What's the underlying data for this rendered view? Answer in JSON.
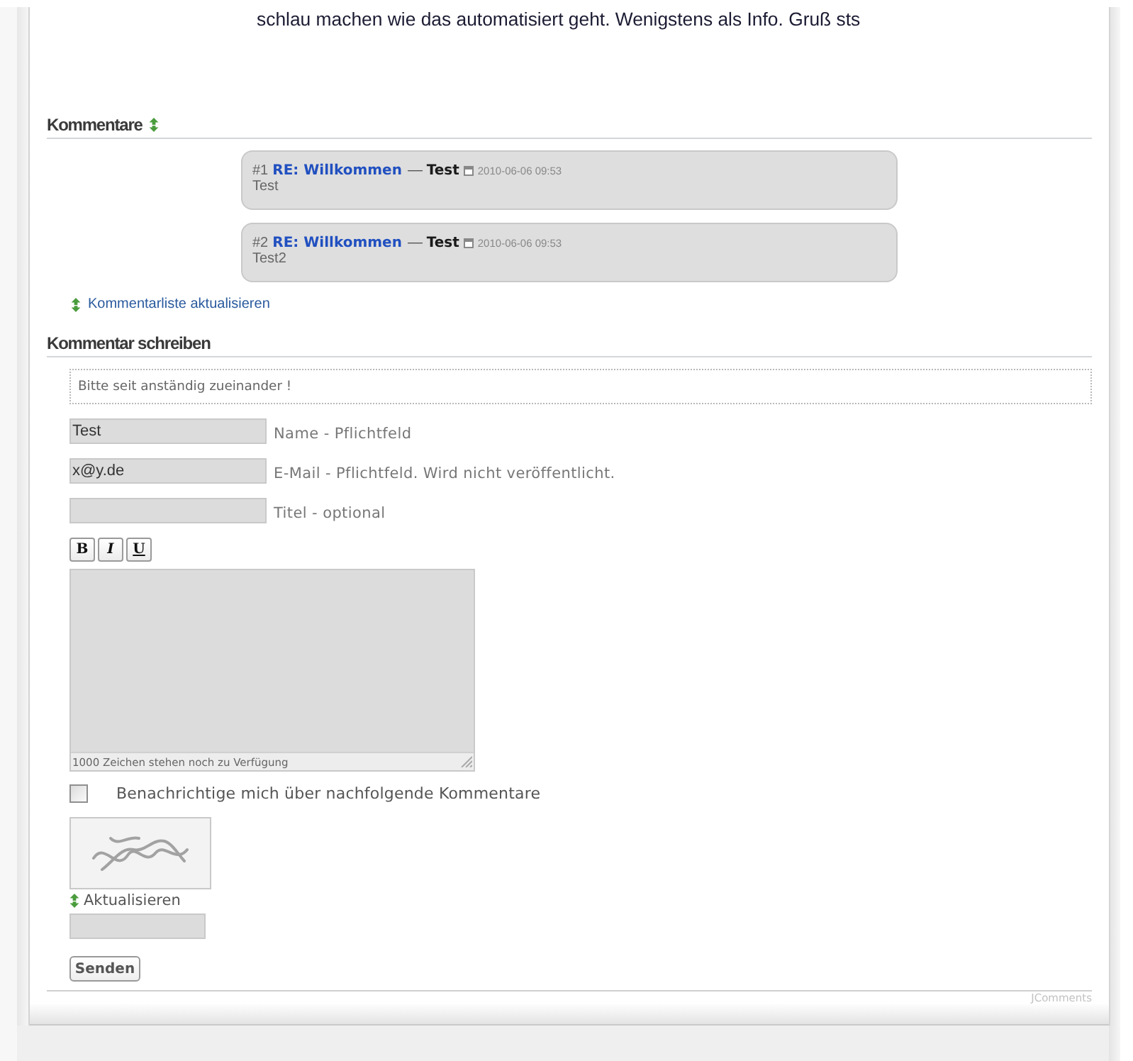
{
  "post": {
    "text": "schlau machen wie das automatisiert geht. Wenigstens als Info. Gruß sts"
  },
  "comments_section": {
    "title": "Kommentare",
    "comments": [
      {
        "number": "#1",
        "title": "RE: Willkommen",
        "author": "— **Test**",
        "date": "2010-06-06 09:53",
        "text": "Test"
      },
      {
        "number": "#2",
        "title": "RE: Willkommen",
        "author": "— **Test**",
        "date": "2010-06-06 09:53",
        "text": "Test2"
      }
    ],
    "refresh_link": "Kommentarliste aktualisieren"
  },
  "form": {
    "title": "Kommentar schreiben",
    "notice": "Bitte seit anständig zueinander !",
    "fields": [
      {
        "value": "Test",
        "label": "Name - Pflichtfeld"
      },
      {
        "value": "x@y.de",
        "label": "E-Mail - Pflichtfeld. Wird nicht veröffentlicht."
      },
      {
        "label": "Titel - optional"
      }
    ],
    "format_buttons": [
      {
        "label": "B",
        "kind": "bold"
      },
      {
        "label": "I",
        "kind": "italic"
      },
      {
        "label": "U",
        "kind": "underline"
      }
    ],
    "message": {
      "counter": "1000 Zeichen stehen noch zu Verfügung"
    },
    "subscribe": {
      "label": "Benachrichtige mich über nachfolgende Kommentare",
      "checked": false
    },
    "captcha": {
      "refresh_link": "Aktualisieren"
    },
    "submit": "Senden"
  },
  "footer": {
    "credit": "JComments"
  }
}
